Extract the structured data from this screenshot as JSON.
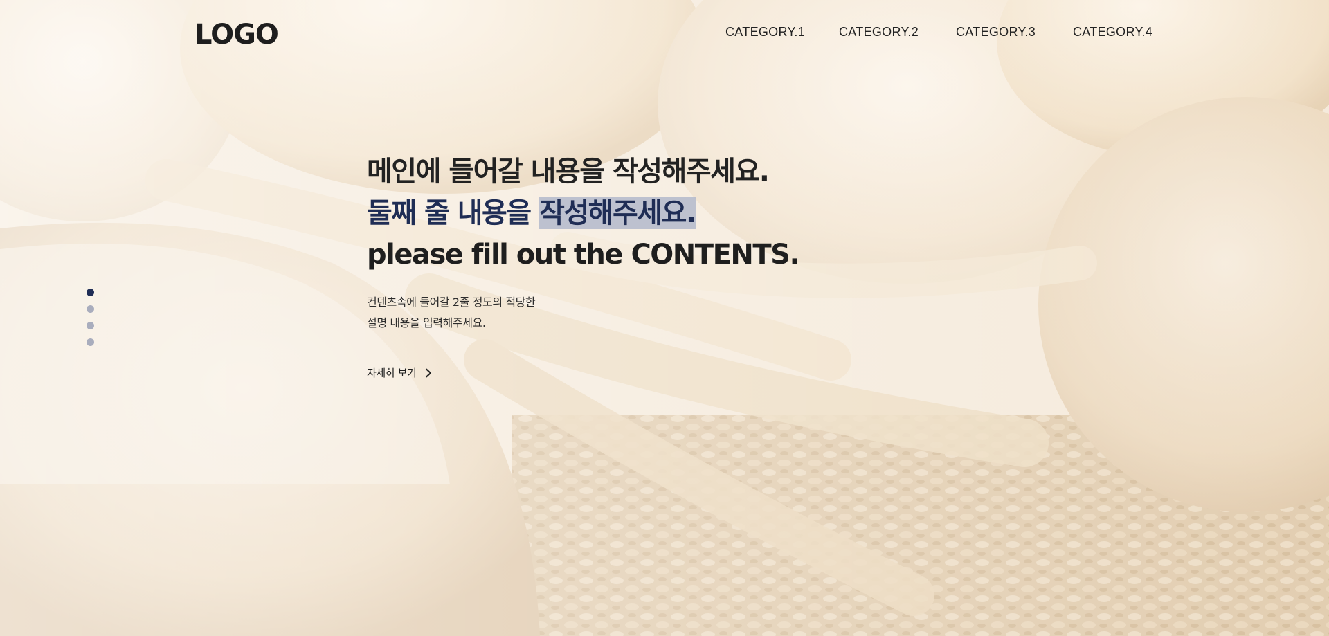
{
  "header": {
    "logo": "LOGO",
    "nav": [
      {
        "label": "CATEGORY.1"
      },
      {
        "label": "CATEGORY.2"
      },
      {
        "label": "CATEGORY.3"
      },
      {
        "label": "CATEGORY.4"
      }
    ]
  },
  "hero": {
    "line1": "메인에 들어갈 내용을 작성해주세요.",
    "line2_plain": "둘째 줄 내용을 ",
    "line2_highlight": "작성해주세요.",
    "line3": "please fill out the CONTENTS.",
    "desc_line1": "컨텐츠속에 들어갈 2줄 정도의 적당한",
    "desc_line2": "설명 내용을 입력해주세요.",
    "more_label": "자세히 보기",
    "more_icon": "chevron-right-icon"
  },
  "slider": {
    "count": 4,
    "active_index": 0
  },
  "colors": {
    "accent": "#1f2d55",
    "dot_inactive": "#a9adbd",
    "highlight": "#aab2c8",
    "text": "#222222"
  }
}
